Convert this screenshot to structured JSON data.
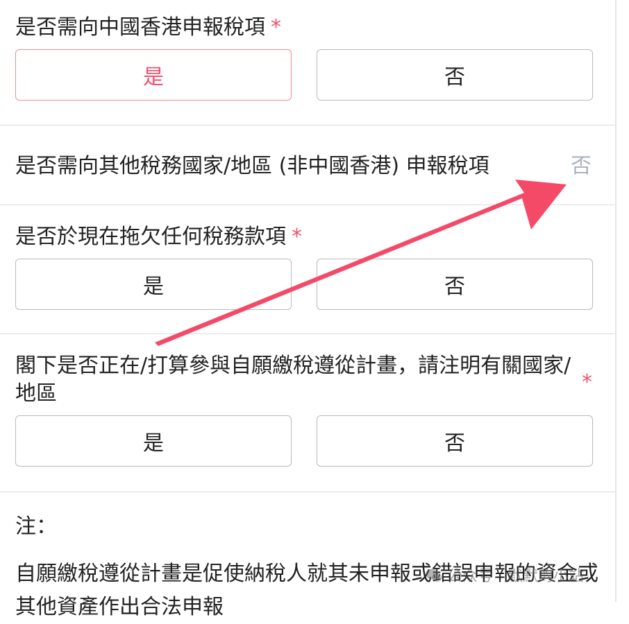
{
  "colors": {
    "required": "#f0506e",
    "selected_border": "#f28a99",
    "divider": "#dddddd",
    "arrow": "#f44a68",
    "muted_value": "#a9b3bd"
  },
  "sections": {
    "hk_tax": {
      "label": "是否需向中國香港申報稅項",
      "required_mark": "*",
      "yes": "是",
      "no": "否",
      "selected": "是"
    },
    "other_tax": {
      "label": "是否需向其他稅務國家/地區 (非中國香港) 申報稅項",
      "value": "否"
    },
    "arrears": {
      "label": "是否於現在拖欠任何稅務款項",
      "required_mark": "*",
      "yes": "是",
      "no": "否"
    },
    "voluntary": {
      "label": "閣下是否正在/打算參與自願繳稅遵從計畫，請注明有關國家/地區",
      "required_mark": "*",
      "yes": "是",
      "no": "否"
    }
  },
  "note": {
    "title": "注：",
    "body": "自願繳稅遵從計畫是促使納稅人就其未申報或錯誤申報的資金或其他資產作出合法申報"
  },
  "watermark": {
    "icon": "wechat-icon",
    "text": "公众号 · 默默的小站"
  }
}
